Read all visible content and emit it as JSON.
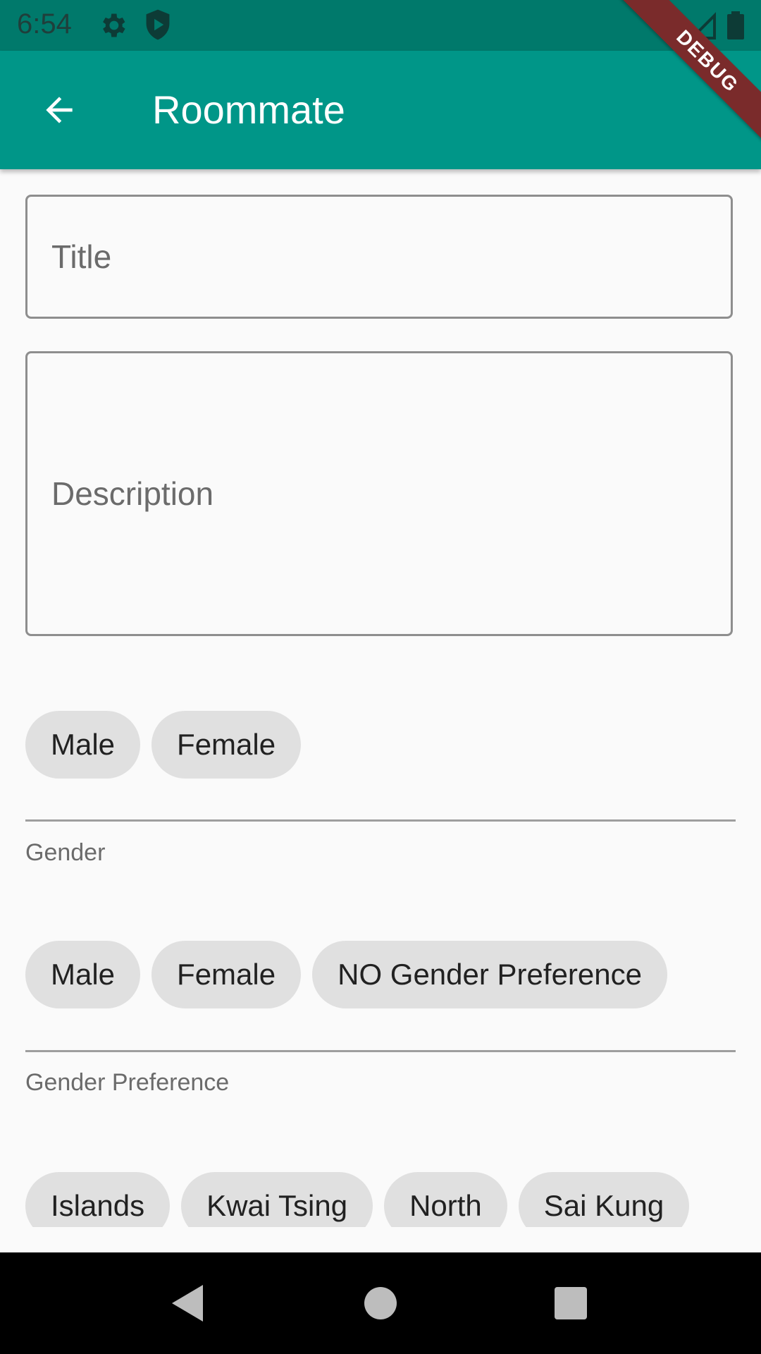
{
  "status_bar": {
    "time": "6:54"
  },
  "app_bar": {
    "title": "Roommate"
  },
  "debug_banner": "DEBUG",
  "form": {
    "title_label": "Title",
    "description_label": "Description"
  },
  "gender": {
    "options": [
      "Male",
      "Female"
    ],
    "label": "Gender"
  },
  "gender_preference": {
    "options": [
      "Male",
      "Female",
      "NO Gender Preference"
    ],
    "label": "Gender Preference"
  },
  "districts": {
    "options": [
      "Islands",
      "Kwai Tsing",
      "North",
      "Sai Kung"
    ]
  },
  "colors": {
    "app_bar": "#009688",
    "status_bar": "#00796b",
    "chip": "#e0e0e0"
  }
}
